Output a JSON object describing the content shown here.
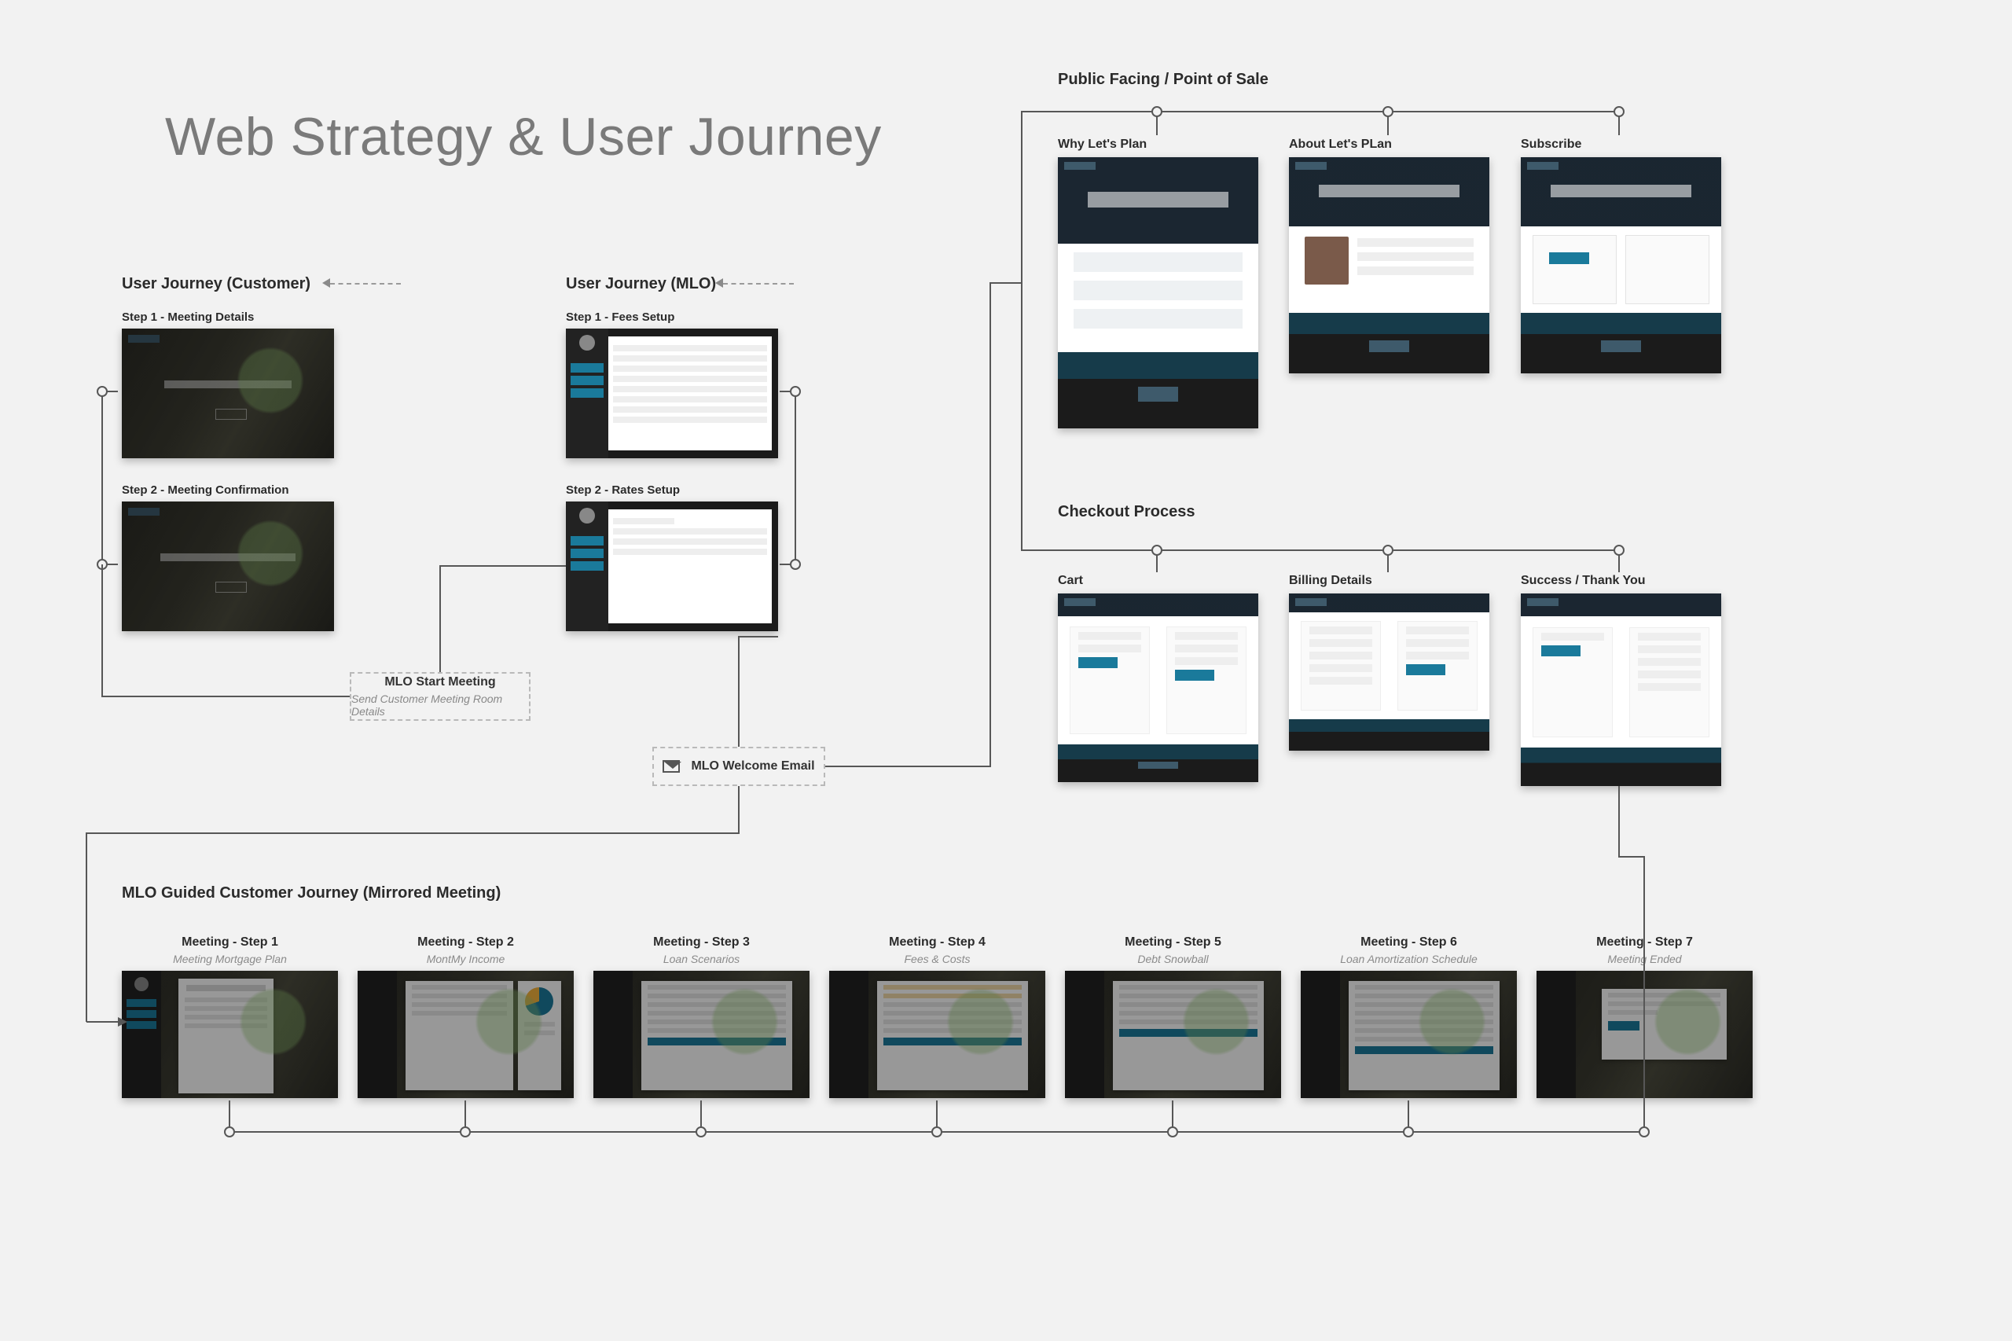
{
  "title": "Web Strategy & User Journey",
  "sections": {
    "customer_journey": "User Journey (Customer)",
    "mlo_journey": "User Journey (MLO)",
    "public_facing": "Public Facing / Point of Sale",
    "checkout": "Checkout Process",
    "guided": "MLO Guided Customer Journey (Mirrored Meeting)"
  },
  "customer_steps": [
    {
      "label": "Step 1 - Meeting Details"
    },
    {
      "label": "Step 2 - Meeting Confirmation"
    }
  ],
  "mlo_steps": [
    {
      "label": "Step 1 - Fees Setup"
    },
    {
      "label": "Step 2 - Rates Setup"
    }
  ],
  "public_pages": [
    {
      "label": "Why Let's Plan"
    },
    {
      "label": "About  Let's PLan"
    },
    {
      "label": "Subscribe"
    }
  ],
  "checkout_pages": [
    {
      "label": "Cart"
    },
    {
      "label": "Billing Details"
    },
    {
      "label": "Success / Thank You"
    }
  ],
  "guided_steps": [
    {
      "title": "Meeting - Step 1",
      "sub": "Meeting Mortgage Plan"
    },
    {
      "title": "Meeting - Step 2",
      "sub": "MontMy Income"
    },
    {
      "title": "Meeting - Step 3",
      "sub": "Loan Scenarios"
    },
    {
      "title": "Meeting - Step 4",
      "sub": "Fees & Costs"
    },
    {
      "title": "Meeting - Step 5",
      "sub": "Debt Snowball"
    },
    {
      "title": "Meeting - Step 6",
      "sub": "Loan Amortization Schedule"
    },
    {
      "title": "Meeting - Step 7",
      "sub": "Meeting Ended"
    }
  ],
  "actions": {
    "start_meeting": {
      "title": "MLO Start Meeting",
      "sub": "Send Customer Meeting Room Details"
    },
    "welcome_email": {
      "title": "MLO Welcome Email"
    }
  },
  "colors": {
    "bg": "#f2f2f2",
    "accent": "#1a7a9b",
    "connector": "#575757"
  }
}
